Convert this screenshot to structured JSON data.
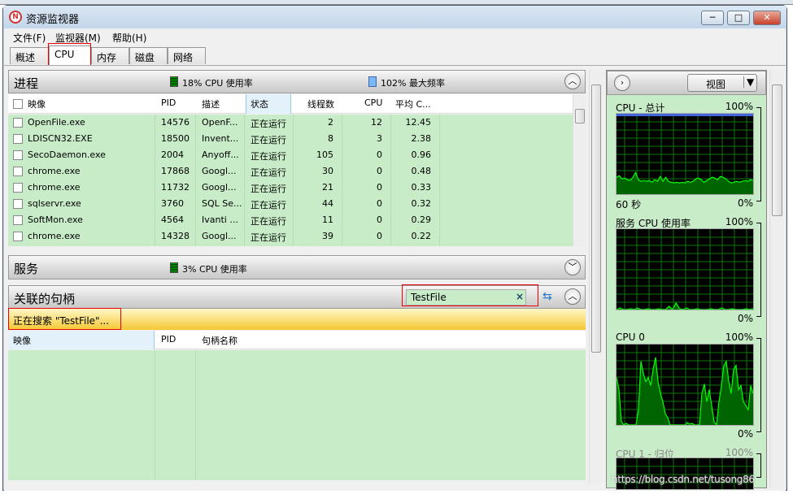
{
  "window": {
    "title": "资源监视器",
    "minimize": "─",
    "maximize": "□",
    "close": "✕"
  },
  "menu": [
    "文件(F)",
    "监视器(M)",
    "帮助(H)"
  ],
  "tabs": [
    {
      "label": "概述"
    },
    {
      "label": "CPU",
      "active": true
    },
    {
      "label": "内存"
    },
    {
      "label": "磁盘"
    },
    {
      "label": "网络"
    }
  ],
  "processes": {
    "title": "进程",
    "cpu_usage": "18% CPU 使用率",
    "max_freq": "102% 最大频率",
    "columns": [
      "映像",
      "PID",
      "描述",
      "状态",
      "线程数",
      "CPU",
      "平均 C..."
    ],
    "rows": [
      [
        "OpenFile.exe",
        "14576",
        "OpenF...",
        "正在运行",
        "2",
        "12",
        "12.45"
      ],
      [
        "LDISCN32.EXE",
        "18500",
        "Invent...",
        "正在运行",
        "8",
        "3",
        "2.38"
      ],
      [
        "SecoDaemon.exe",
        "2004",
        "Anyoff...",
        "正在运行",
        "105",
        "0",
        "0.96"
      ],
      [
        "chrome.exe",
        "17868",
        "Googl...",
        "正在运行",
        "30",
        "0",
        "0.48"
      ],
      [
        "chrome.exe",
        "11732",
        "Googl...",
        "正在运行",
        "21",
        "0",
        "0.33"
      ],
      [
        "sqlservr.exe",
        "3760",
        "SQL Se...",
        "正在运行",
        "44",
        "0",
        "0.32"
      ],
      [
        "SoftMon.exe",
        "4564",
        "Ivanti ...",
        "正在运行",
        "11",
        "0",
        "0.29"
      ],
      [
        "chrome.exe",
        "14328",
        "Googl...",
        "正在运行",
        "39",
        "0",
        "0.22"
      ]
    ]
  },
  "services": {
    "title": "服务",
    "cpu_usage": "3% CPU 使用率"
  },
  "handles": {
    "title": "关联的句柄",
    "search_value": "TestFile",
    "searching": "正在搜索 \"TestFile\"...",
    "columns": [
      "映像",
      "PID",
      "句柄名称"
    ]
  },
  "right": {
    "view_button": "视图",
    "graphs": [
      {
        "label": "CPU - 总计",
        "max": "100%",
        "min": "0%",
        "time": "60 秒",
        "values": [
          22,
          24,
          20,
          21,
          19,
          18,
          22,
          28,
          19,
          17,
          18,
          17,
          18,
          16,
          19,
          17,
          23,
          17,
          22,
          17,
          16,
          15,
          16,
          15,
          16,
          15,
          17,
          16,
          17,
          20,
          21,
          19,
          16,
          18,
          20,
          22,
          21,
          19,
          23,
          22,
          20,
          17,
          15,
          16,
          17,
          16,
          17,
          18,
          17,
          19,
          18
        ]
      },
      {
        "label": "服务 CPU 使用率",
        "max": "100%",
        "min": "0%",
        "values": [
          1,
          3,
          1,
          1,
          2,
          1,
          3,
          1,
          1,
          2,
          1,
          1,
          2,
          1,
          1,
          5,
          1,
          9,
          2,
          1,
          3,
          1,
          1,
          2,
          1,
          1,
          1,
          2,
          1,
          1,
          3,
          1,
          1,
          2,
          1,
          1,
          1,
          2,
          1,
          2
        ]
      },
      {
        "label": "CPU 0",
        "max": "100%",
        "min": "0%",
        "values": [
          60,
          45,
          5,
          1,
          3,
          1,
          1,
          1,
          1,
          20,
          80,
          65,
          55,
          60,
          50,
          70,
          85,
          55,
          40,
          30,
          15,
          10,
          1,
          1,
          1,
          1,
          1,
          1,
          1,
          4,
          2,
          3,
          1,
          1,
          1,
          40,
          52,
          30,
          45,
          25,
          5,
          1,
          30,
          50,
          75,
          80,
          55,
          40,
          70,
          75,
          45,
          50,
          30,
          25,
          20,
          50,
          40
        ]
      },
      {
        "label": "CPU 1 - 归位",
        "max": "100%"
      }
    ],
    "graph_color": "#00ff00"
  },
  "watermark": "https://blog.csdn.net/tusong86"
}
